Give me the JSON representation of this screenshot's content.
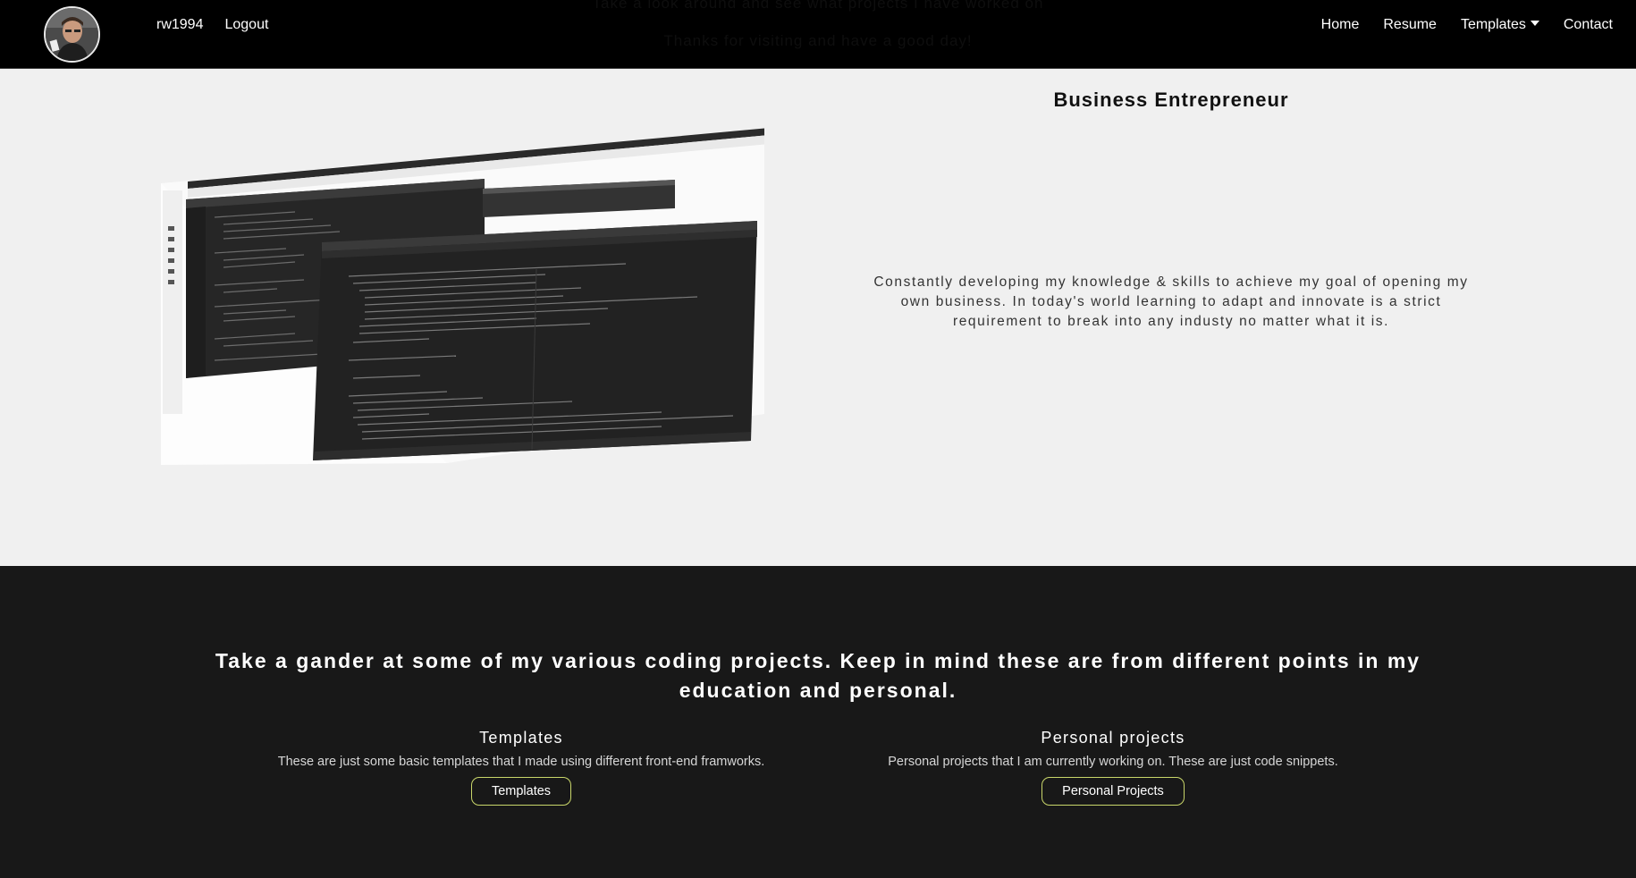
{
  "navbar": {
    "ghost_line_1": "Take a look around and see what projects I have worked on",
    "ghost_line_2": "Thanks for visiting and have a good day!",
    "avatar_alt": "profile picture",
    "username": "rw1994",
    "logout": "Logout",
    "links": {
      "home": "Home",
      "resume": "Resume",
      "templates": "Templates",
      "contact": "Contact"
    }
  },
  "hero": {
    "heading": "Business Entrepreneur",
    "text": "Constantly developing my knowledge & skills to achieve my goal of opening my own business. In today's world learning to adapt and innovate is a strict requirement to break into any industy no matter what it is."
  },
  "projects": {
    "heading": "Take a gander at some of my various coding projects. Keep in mind these are from different points in my education and personal.",
    "templates": {
      "title": "Templates",
      "description": "These are just some basic templates that I made using different front-end framworks.",
      "button": "Templates"
    },
    "personal": {
      "title": "Personal projects",
      "description": "Personal projects that I am currently working on. These are just code snippets.",
      "button": "Personal Projects"
    }
  },
  "colors": {
    "nav_bg": "#000000",
    "hero_bg": "#f0f0f0",
    "projects_bg": "#181818",
    "button_border": "#c9d66a"
  }
}
